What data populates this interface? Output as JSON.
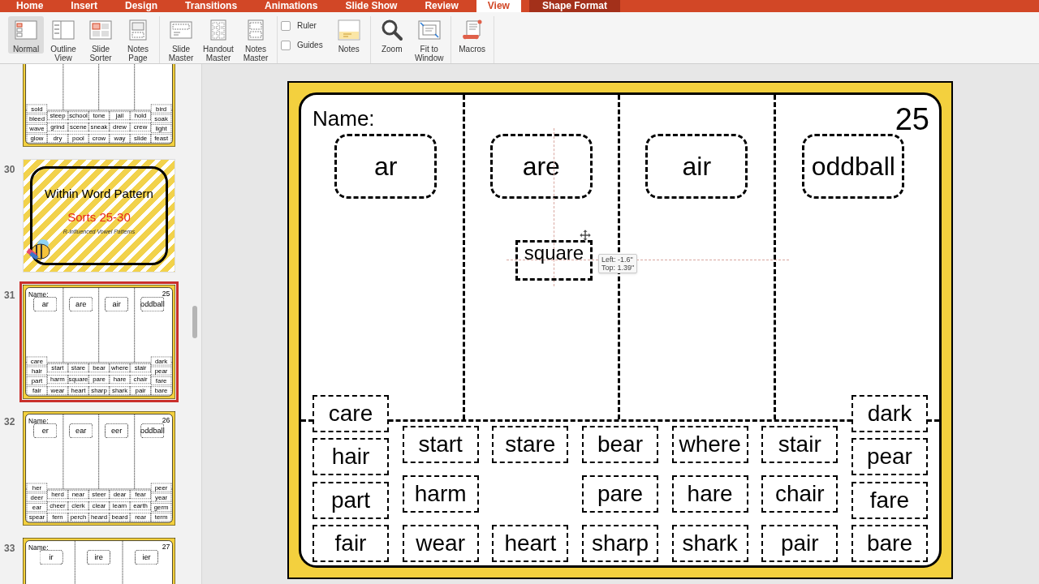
{
  "ribbon": {
    "tabs": [
      {
        "label": "Home",
        "selected": false,
        "kind": "tab"
      },
      {
        "label": "Insert",
        "selected": false,
        "kind": "tab"
      },
      {
        "label": "Design",
        "selected": false,
        "kind": "tab"
      },
      {
        "label": "Transitions",
        "selected": false,
        "kind": "tab"
      },
      {
        "label": "Animations",
        "selected": false,
        "kind": "tab"
      },
      {
        "label": "Slide Show",
        "selected": false,
        "kind": "tab"
      },
      {
        "label": "Review",
        "selected": false,
        "kind": "tab"
      },
      {
        "label": "View",
        "selected": true,
        "kind": "tab"
      },
      {
        "label": "Shape Format",
        "selected": false,
        "kind": "contextual"
      }
    ],
    "groups": [
      {
        "items": [
          {
            "kind": "view",
            "label": "Normal",
            "selected": true
          },
          {
            "kind": "view",
            "label": "Outline View",
            "selected": false
          },
          {
            "kind": "view",
            "label": "Slide Sorter",
            "selected": false
          },
          {
            "kind": "view",
            "label": "Notes Page",
            "selected": false
          }
        ]
      },
      {
        "items": [
          {
            "kind": "view",
            "label": "Slide Master",
            "selected": false
          },
          {
            "kind": "view",
            "label": "Handout Master",
            "selected": false
          },
          {
            "kind": "view",
            "label": "Notes Master",
            "selected": false
          }
        ]
      },
      {
        "items": [
          {
            "kind": "checkbox",
            "label": "Ruler",
            "checked": false
          },
          {
            "kind": "checkbox",
            "label": "Guides",
            "checked": false
          },
          {
            "kind": "command",
            "label": "Notes"
          }
        ]
      },
      {
        "items": [
          {
            "kind": "command",
            "label": "Zoom"
          },
          {
            "kind": "command",
            "label": "Fit to Window"
          }
        ]
      },
      {
        "items": [
          {
            "kind": "command",
            "label": "Macros"
          }
        ]
      }
    ]
  },
  "slide_panel": {
    "slides": [
      {
        "kind": "sort",
        "selected": false,
        "word_columns": [
          [
            "sold",
            "bleed",
            "wave",
            "glow"
          ],
          [
            "steep",
            "grind",
            "dry"
          ],
          [
            "school",
            "scene",
            "pool"
          ],
          [
            "tone",
            "sneak",
            "crow"
          ],
          [
            "jail",
            "drew",
            "way"
          ],
          [
            "hold",
            "crew",
            "slide"
          ],
          [
            "bird",
            "soak",
            "light",
            "feast"
          ]
        ]
      },
      {
        "kind": "title",
        "number": "30",
        "selected": false,
        "title": "Within Word Pattern",
        "subtitle": "Sorts 25-30",
        "tagline": "R-Influenced Vowel Patterns"
      },
      {
        "kind": "sort",
        "number": "31",
        "selected": true,
        "name_label": "Name:",
        "sort_number": "25",
        "headers": [
          "ar",
          "are",
          "air",
          "oddball"
        ],
        "word_columns": [
          [
            "care",
            "hair",
            "part",
            "fair"
          ],
          [
            "start",
            "harm",
            "wear"
          ],
          [
            "stare",
            "square",
            "heart"
          ],
          [
            "bear",
            "pare",
            "sharp"
          ],
          [
            "where",
            "hare",
            "shark"
          ],
          [
            "stair",
            "chair",
            "pair"
          ],
          [
            "dark",
            "pear",
            "fare",
            "bare"
          ]
        ]
      },
      {
        "kind": "sort",
        "number": "32",
        "selected": false,
        "name_label": "Name:",
        "sort_number": "26",
        "headers": [
          "er",
          "ear",
          "eer",
          "oddball"
        ],
        "word_columns": [
          [
            "her",
            "deer",
            "ear",
            "spear"
          ],
          [
            "herd",
            "cheer",
            "fern"
          ],
          [
            "near",
            "clerk",
            "perch"
          ],
          [
            "steer",
            "clear",
            "heard"
          ],
          [
            "dear",
            "learn",
            "beard"
          ],
          [
            "fear",
            "earth",
            "rear"
          ],
          [
            "peer",
            "year",
            "germ",
            "term"
          ]
        ]
      },
      {
        "kind": "sort",
        "number": "33",
        "selected": false,
        "name_label": "Name:",
        "sort_number": "27",
        "headers": [
          "ir",
          "ire",
          "ier"
        ]
      }
    ]
  },
  "editor_slide": {
    "name_label": "Name:",
    "sort_number": "25",
    "headers": [
      "ar",
      "are",
      "air",
      "oddball"
    ],
    "word_columns": [
      [
        "care",
        "hair",
        "part",
        "fair"
      ],
      [
        "start",
        "harm",
        "wear"
      ],
      [
        "stare",
        "heart"
      ],
      [
        "bear",
        "pare",
        "sharp"
      ],
      [
        "where",
        "hare",
        "shark"
      ],
      [
        "stair",
        "chair",
        "pair"
      ],
      [
        "dark",
        "pear",
        "fare",
        "bare"
      ]
    ],
    "dragged_card": {
      "text": "square"
    },
    "tooltip": {
      "lines": [
        "Left: -1.6\"",
        "Top: 1.39\""
      ]
    }
  }
}
